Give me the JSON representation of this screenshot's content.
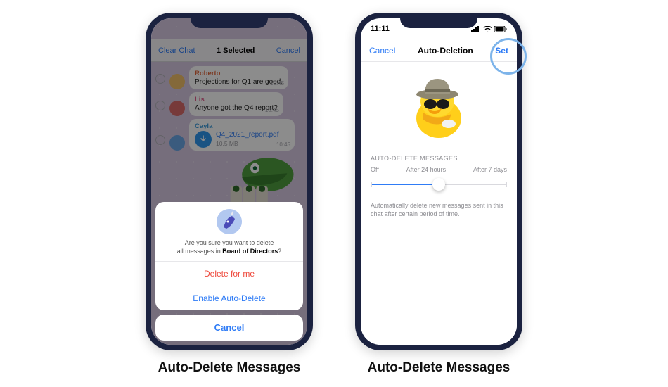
{
  "status": {
    "time": "11:11"
  },
  "phone1": {
    "topbar": {
      "left": "Clear Chat",
      "title": "1 Selected",
      "right": "Cancel"
    },
    "messages": [
      {
        "name": "Roberto",
        "name_color": "#e0653a",
        "text": "Projections for Q1 are good.",
        "time": "10:45",
        "avatar_bg": "#f0c06a"
      },
      {
        "name": "Lis",
        "name_color": "#e05a8a",
        "text": "Anyone got the Q4 report?",
        "time": "10:45",
        "avatar_bg": "#d96a6a"
      },
      {
        "name": "Cayla",
        "name_color": "#3a9ad9",
        "file": "Q4_2021_report.pdf",
        "size": "10.5 MB",
        "time": "10:45",
        "avatar_bg": "#6aa6e6"
      }
    ],
    "sheet": {
      "question_prefix": "Are you sure you want to delete",
      "question_line2_a": "all messages in ",
      "question_bold": "Board of Directors",
      "opt_delete": "Delete for me",
      "opt_auto": "Enable Auto-Delete",
      "cancel": "Cancel"
    },
    "caption": "Auto-Delete Messages"
  },
  "phone2": {
    "nav": {
      "left": "Cancel",
      "title": "Auto-Deletion",
      "right": "Set"
    },
    "section_label": "AUTO-DELETE MESSAGES",
    "slider": {
      "opts": [
        "Off",
        "After 24 hours",
        "After 7 days"
      ],
      "position": 1
    },
    "description": "Automatically delete new messages sent in this chat after certain period of time.",
    "caption": "Auto-Delete Messages"
  }
}
